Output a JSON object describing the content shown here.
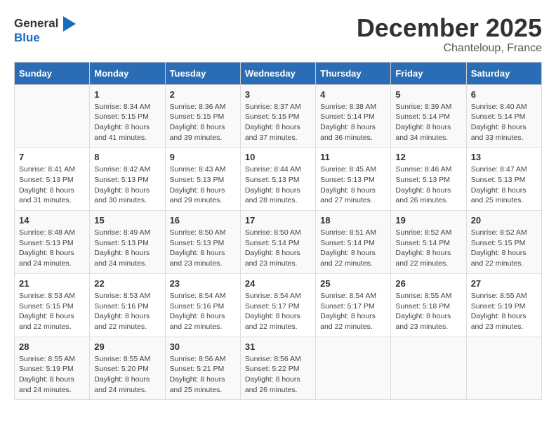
{
  "logo": {
    "general": "General",
    "blue": "Blue"
  },
  "title": "December 2025",
  "location": "Chanteloup, France",
  "days_of_week": [
    "Sunday",
    "Monday",
    "Tuesday",
    "Wednesday",
    "Thursday",
    "Friday",
    "Saturday"
  ],
  "weeks": [
    [
      {
        "day": "",
        "info": ""
      },
      {
        "day": "1",
        "info": "Sunrise: 8:34 AM\nSunset: 5:15 PM\nDaylight: 8 hours\nand 41 minutes."
      },
      {
        "day": "2",
        "info": "Sunrise: 8:36 AM\nSunset: 5:15 PM\nDaylight: 8 hours\nand 39 minutes."
      },
      {
        "day": "3",
        "info": "Sunrise: 8:37 AM\nSunset: 5:15 PM\nDaylight: 8 hours\nand 37 minutes."
      },
      {
        "day": "4",
        "info": "Sunrise: 8:38 AM\nSunset: 5:14 PM\nDaylight: 8 hours\nand 36 minutes."
      },
      {
        "day": "5",
        "info": "Sunrise: 8:39 AM\nSunset: 5:14 PM\nDaylight: 8 hours\nand 34 minutes."
      },
      {
        "day": "6",
        "info": "Sunrise: 8:40 AM\nSunset: 5:14 PM\nDaylight: 8 hours\nand 33 minutes."
      }
    ],
    [
      {
        "day": "7",
        "info": "Sunrise: 8:41 AM\nSunset: 5:13 PM\nDaylight: 8 hours\nand 31 minutes."
      },
      {
        "day": "8",
        "info": "Sunrise: 8:42 AM\nSunset: 5:13 PM\nDaylight: 8 hours\nand 30 minutes."
      },
      {
        "day": "9",
        "info": "Sunrise: 8:43 AM\nSunset: 5:13 PM\nDaylight: 8 hours\nand 29 minutes."
      },
      {
        "day": "10",
        "info": "Sunrise: 8:44 AM\nSunset: 5:13 PM\nDaylight: 8 hours\nand 28 minutes."
      },
      {
        "day": "11",
        "info": "Sunrise: 8:45 AM\nSunset: 5:13 PM\nDaylight: 8 hours\nand 27 minutes."
      },
      {
        "day": "12",
        "info": "Sunrise: 8:46 AM\nSunset: 5:13 PM\nDaylight: 8 hours\nand 26 minutes."
      },
      {
        "day": "13",
        "info": "Sunrise: 8:47 AM\nSunset: 5:13 PM\nDaylight: 8 hours\nand 25 minutes."
      }
    ],
    [
      {
        "day": "14",
        "info": "Sunrise: 8:48 AM\nSunset: 5:13 PM\nDaylight: 8 hours\nand 24 minutes."
      },
      {
        "day": "15",
        "info": "Sunrise: 8:49 AM\nSunset: 5:13 PM\nDaylight: 8 hours\nand 24 minutes."
      },
      {
        "day": "16",
        "info": "Sunrise: 8:50 AM\nSunset: 5:13 PM\nDaylight: 8 hours\nand 23 minutes."
      },
      {
        "day": "17",
        "info": "Sunrise: 8:50 AM\nSunset: 5:14 PM\nDaylight: 8 hours\nand 23 minutes."
      },
      {
        "day": "18",
        "info": "Sunrise: 8:51 AM\nSunset: 5:14 PM\nDaylight: 8 hours\nand 22 minutes."
      },
      {
        "day": "19",
        "info": "Sunrise: 8:52 AM\nSunset: 5:14 PM\nDaylight: 8 hours\nand 22 minutes."
      },
      {
        "day": "20",
        "info": "Sunrise: 8:52 AM\nSunset: 5:15 PM\nDaylight: 8 hours\nand 22 minutes."
      }
    ],
    [
      {
        "day": "21",
        "info": "Sunrise: 8:53 AM\nSunset: 5:15 PM\nDaylight: 8 hours\nand 22 minutes."
      },
      {
        "day": "22",
        "info": "Sunrise: 8:53 AM\nSunset: 5:16 PM\nDaylight: 8 hours\nand 22 minutes."
      },
      {
        "day": "23",
        "info": "Sunrise: 8:54 AM\nSunset: 5:16 PM\nDaylight: 8 hours\nand 22 minutes."
      },
      {
        "day": "24",
        "info": "Sunrise: 8:54 AM\nSunset: 5:17 PM\nDaylight: 8 hours\nand 22 minutes."
      },
      {
        "day": "25",
        "info": "Sunrise: 8:54 AM\nSunset: 5:17 PM\nDaylight: 8 hours\nand 22 minutes."
      },
      {
        "day": "26",
        "info": "Sunrise: 8:55 AM\nSunset: 5:18 PM\nDaylight: 8 hours\nand 23 minutes."
      },
      {
        "day": "27",
        "info": "Sunrise: 8:55 AM\nSunset: 5:19 PM\nDaylight: 8 hours\nand 23 minutes."
      }
    ],
    [
      {
        "day": "28",
        "info": "Sunrise: 8:55 AM\nSunset: 5:19 PM\nDaylight: 8 hours\nand 24 minutes."
      },
      {
        "day": "29",
        "info": "Sunrise: 8:55 AM\nSunset: 5:20 PM\nDaylight: 8 hours\nand 24 minutes."
      },
      {
        "day": "30",
        "info": "Sunrise: 8:56 AM\nSunset: 5:21 PM\nDaylight: 8 hours\nand 25 minutes."
      },
      {
        "day": "31",
        "info": "Sunrise: 8:56 AM\nSunset: 5:22 PM\nDaylight: 8 hours\nand 26 minutes."
      },
      {
        "day": "",
        "info": ""
      },
      {
        "day": "",
        "info": ""
      },
      {
        "day": "",
        "info": ""
      }
    ]
  ]
}
